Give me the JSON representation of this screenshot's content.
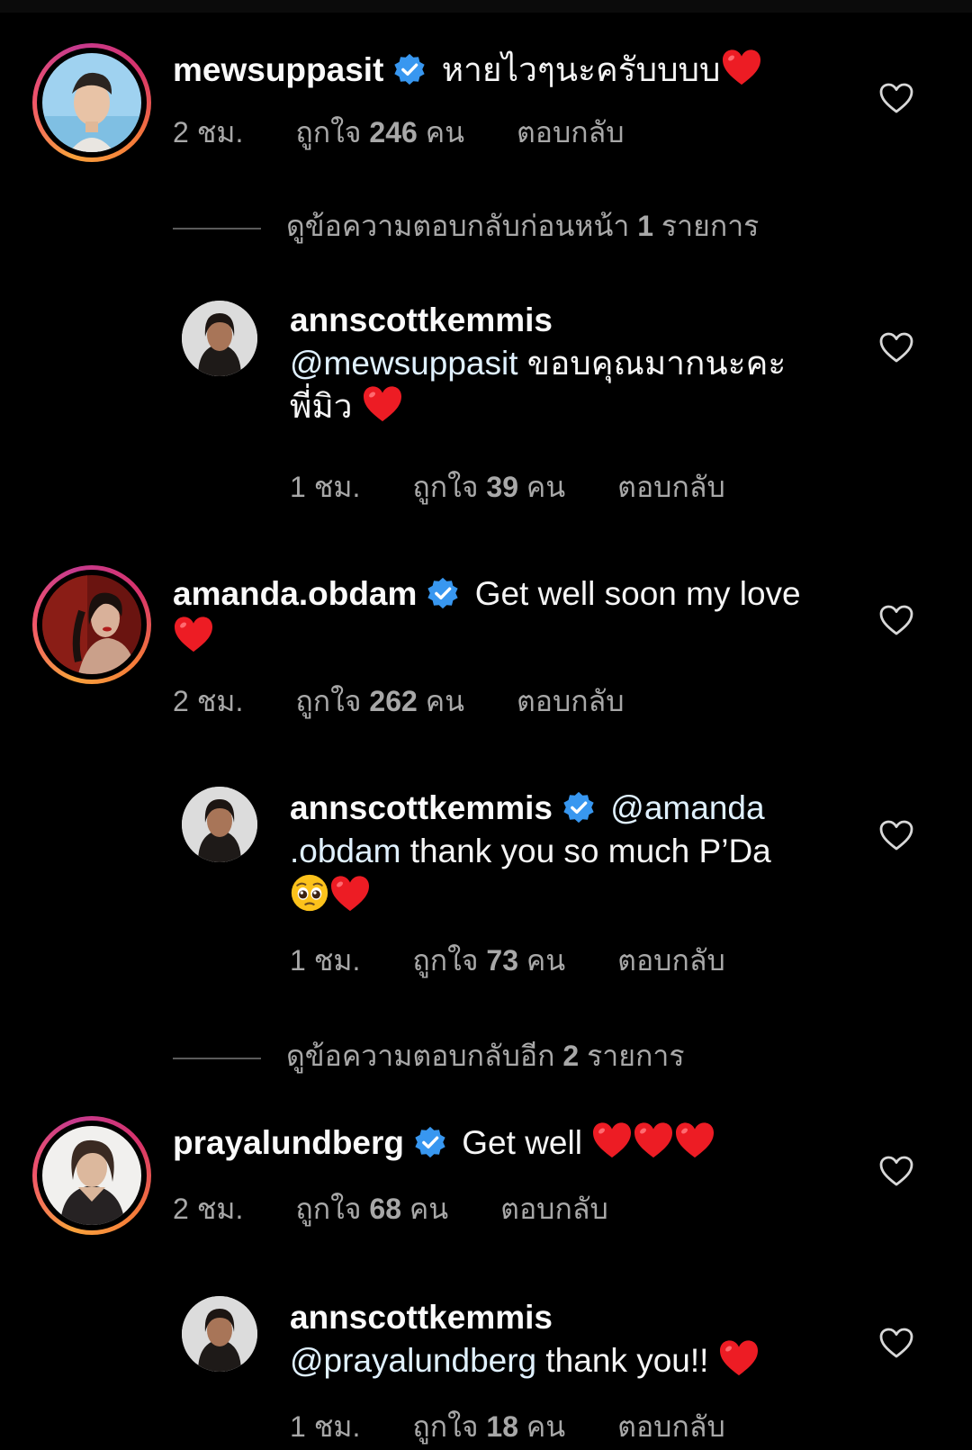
{
  "colors": {
    "background": "#000000",
    "text": "#f5f5f5",
    "muted": "#a8a8a8",
    "verified": "#3897f0",
    "heart": "#ed1c24"
  },
  "comments": [
    {
      "username": "mewsuppasit",
      "verified": true,
      "text": "หายไวๆนะครับบบบ",
      "emoji": "red-heart",
      "time": "2 ชม.",
      "likes_prefix": "ถูกใจ",
      "likes_count": "246",
      "likes_suffix": "คน",
      "reply": "ตอบกลับ"
    },
    {
      "username": "amanda.obdam",
      "verified": true,
      "text": "Get well soon my love",
      "emoji": "red-heart",
      "time": "2 ชม.",
      "likes_prefix": "ถูกใจ",
      "likes_count": "262",
      "likes_suffix": "คน",
      "reply": "ตอบกลับ"
    },
    {
      "username": "prayalundberg",
      "verified": true,
      "text": "Get well",
      "emoji": "red-heart x3",
      "time": "2 ชม.",
      "likes_prefix": "ถูกใจ",
      "likes_count": "68",
      "likes_suffix": "คน",
      "reply": "ตอบกลับ"
    }
  ],
  "replies": [
    {
      "username": "annscottkemmis",
      "verified": false,
      "mention": "@mewsuppasit",
      "text": "ขอบคุณมากนะคะ",
      "text2": "พี่มิว",
      "emoji": "red-heart",
      "time": "1 ชม.",
      "likes_prefix": "ถูกใจ",
      "likes_count": "39",
      "likes_suffix": "คน",
      "reply": "ตอบกลับ"
    },
    {
      "username": "annscottkemmis",
      "verified": true,
      "mention": "@amanda",
      "mention2": ".obdam",
      "text": "thank you so much P’Da",
      "emoji": "pleading-face red-heart",
      "time": "1 ชม.",
      "likes_prefix": "ถูกใจ",
      "likes_count": "73",
      "likes_suffix": "คน",
      "reply": "ตอบกลับ"
    },
    {
      "username": "annscottkemmis",
      "verified": false,
      "mention": "@prayalundberg",
      "text": "thank you!!",
      "emoji": "red-heart",
      "time": "1 ชม.",
      "likes_prefix": "ถูกใจ",
      "likes_count": "18",
      "likes_suffix": "คน",
      "reply": "ตอบกลับ"
    }
  ],
  "view_more": [
    {
      "text": "ดูข้อความตอบกลับก่อนหน้า",
      "count": "1",
      "unit": "รายการ"
    },
    {
      "text": "ดูข้อความตอบกลับอีก",
      "count": "2",
      "unit": "รายการ"
    }
  ]
}
